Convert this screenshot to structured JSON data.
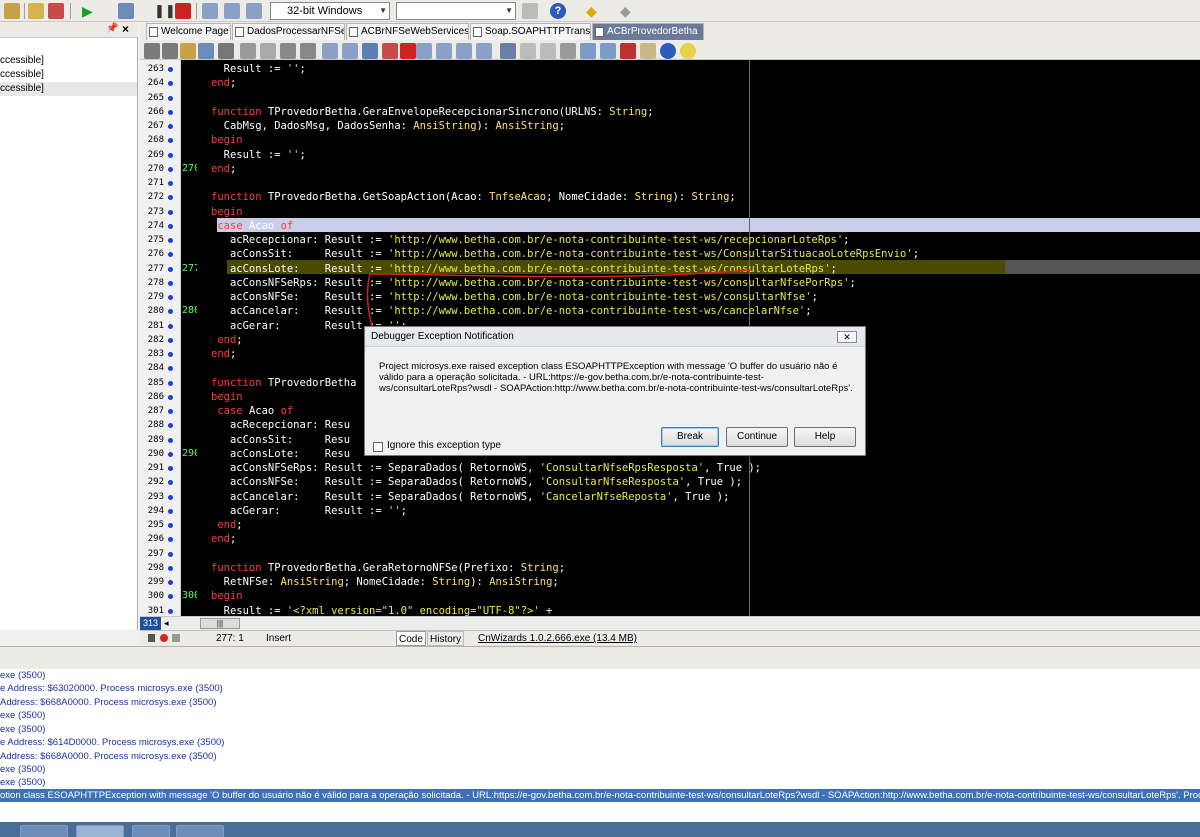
{
  "toolbar": {
    "platform": "32-bit Windows",
    "config": ""
  },
  "left_panel": {
    "items": [
      "ccessible]",
      "ccessible]",
      "ccessible]"
    ],
    "pin": "📌",
    "close": "×"
  },
  "tabs": [
    {
      "label": "Welcome Page"
    },
    {
      "label": "DadosProcessarNFSe"
    },
    {
      "label": "ACBrNFSeWebServices"
    },
    {
      "label": "Soap.SOAPHTTPTrans"
    },
    {
      "label": "ACBrProvedorBetha"
    }
  ],
  "editor": {
    "line_numbers": [
      "263",
      "264",
      "265",
      "266",
      "267",
      "268",
      "269",
      "270",
      "271",
      "272",
      "273",
      "274",
      "275",
      "276",
      "277",
      "278",
      "279",
      "280",
      "281",
      "282",
      "283",
      "284",
      "285",
      "286",
      "287",
      "288",
      "289",
      "290",
      "291",
      "292",
      "293",
      "294",
      "295",
      "296",
      "297",
      "298",
      "299",
      "300",
      "301"
    ],
    "markers": {
      "270": "270",
      "277": "277",
      "280": "280",
      "290": "290",
      "300": "300"
    },
    "lines": [
      "  Result := '';",
      "end;",
      "",
      "function TProvedorBetha.GeraEnvelopeRecepcionarSincrono(URLNS: String;",
      "  CabMsg, DadosMsg, DadosSenha: AnsiString): AnsiString;",
      "begin",
      "  Result := '';",
      "end;",
      "",
      "function TProvedorBetha.GetSoapAction(Acao: TnfseAcao; NomeCidade: String): String;",
      "begin",
      " case Acao of",
      "   acRecepcionar: Result := 'http://www.betha.com.br/e-nota-contribuinte-test-ws/recepcionarLoteRps';",
      "   acConsSit:     Result := 'http://www.betha.com.br/e-nota-contribuinte-test-ws/ConsultarSituacaoLoteRpsEnvio';",
      "   acConsLote:    Result := 'http://www.betha.com.br/e-nota-contribuinte-test-ws/consultarLoteRps';",
      "   acConsNFSeRps: Result := 'http://www.betha.com.br/e-nota-contribuinte-test-ws/consultarNfsePorRps';",
      "   acConsNFSe:    Result := 'http://www.betha.com.br/e-nota-contribuinte-test-ws/consultarNfse';",
      "   acCancelar:    Result := 'http://www.betha.com.br/e-nota-contribuinte-test-ws/cancelarNfse';",
      "   acGerar:       Result := '';",
      " end;",
      "end;",
      "",
      "function TProvedorBetha",
      "begin",
      " case Acao of",
      "   acRecepcionar: Resu",
      "   acConsSit:     Resu",
      "   acConsLote:    Resu",
      "   acConsNFSeRps: Result := SeparaDados( RetornoWS, 'ConsultarNfseRpsResposta', True );",
      "   acConsNFSe:    Result := SeparaDados( RetornoWS, 'ConsultarNfseResposta', True );",
      "   acCancelar:    Result := SeparaDados( RetornoWS, 'CancelarNfseReposta', True );",
      "   acGerar:       Result := '';",
      " end;",
      "end;",
      "",
      "function TProvedorBetha.GeraRetornoNFSe(Prefixo: String;",
      "  RetNFSe: AnsiString; NomeCidade: String): AnsiString;",
      "begin",
      "  Result := '<?xml version=\"1.0\" encoding=\"UTF-8\"?>' +"
    ]
  },
  "status": {
    "position": "277: 1",
    "mode": "Insert",
    "tab_code": "Code",
    "tab_history": "History",
    "cnwizards": "CnWizards 1.0.2.666.exe (13.4 MB)",
    "line_badge": "313"
  },
  "messages": [
    "exe (3500)",
    "e Address: $63020000. Process microsys.exe (3500)",
    "  Address: $668A0000. Process microsys.exe (3500)",
    "exe (3500)",
    "exe (3500)",
    "e Address: $614D0000. Process microsys.exe (3500)",
    "  Address: $668A0000. Process microsys.exe (3500)",
    "exe (3500)",
    "exe (3500)",
    "otion class ESOAPHTTPException with message 'O buffer do usuário não é válido para a operação solicitada. - URL:https://e-gov.betha.com.br/e-nota-contribuinte-test-ws/consultarLoteRps?wsdl - SOAPAction:http://www.betha.com.br/e-nota-contribuinte-test-ws/consultarLoteRps'. Process microsy"
  ],
  "dialog": {
    "title": "Debugger Exception Notification",
    "message": "Project microsys.exe raised exception class ESOAPHTTPException with message 'O buffer do usuário não é válido para a operação solicitada. - URL:https://e-gov.betha.com.br/e-nota-contribuinte-test-ws/consultarLoteRps?wsdl - SOAPAction:http://www.betha.com.br/e-nota-contribuinte-test-ws/consultarLoteRps'.",
    "ignore_label": "Ignore this exception type",
    "break_label": "Break",
    "continue_label": "Continue",
    "help_label": "Help",
    "close_label": "✕"
  }
}
